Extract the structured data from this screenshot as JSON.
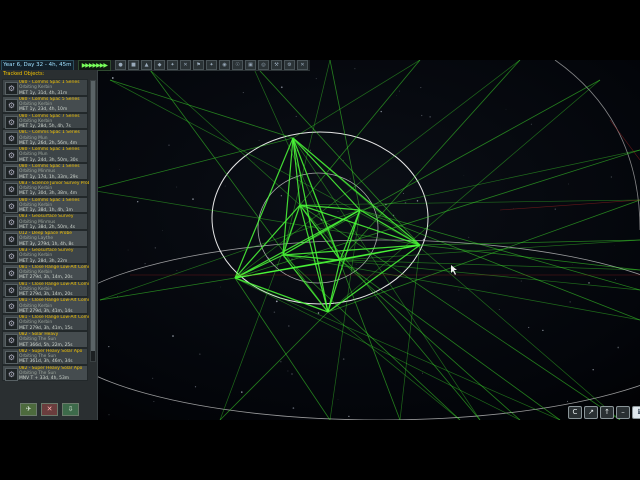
{
  "topbar": {
    "clock": "Year 6, Day 32 - 4h, 45m",
    "warp": "▶▶▶▶▶▶▶",
    "filters": [
      "●",
      "■",
      "▲",
      "◆",
      "✦",
      "✕",
      "⚑",
      "✦",
      "◉",
      "☉",
      "▣",
      "◎",
      "⚒",
      "⚙",
      "✕"
    ]
  },
  "panel": {
    "title": "Tracked Objects:",
    "items": [
      {
        "name": "080 - Comms Spac 1 Series",
        "status": "Orbiting Kerbin",
        "met": "MET 1y, 31d, 4h, 31m"
      },
      {
        "name": "080 - Comms Spac 5 Series",
        "status": "Orbiting Kerbin",
        "met": "MET 1y, 23d, 4h, 10m"
      },
      {
        "name": "080 - Comms Spac 7 Series",
        "status": "Orbiting Kerbin",
        "met": "MET 1y, 28d, 5h, 4h, 7s"
      },
      {
        "name": "08C - Comms Spac 1 Series",
        "status": "Orbiting Mun",
        "met": "MET 1y, 26d, 2h, 56m, 4m"
      },
      {
        "name": "080 - Comms Spac 1 Series",
        "status": "Orbiting Mun",
        "met": "MET 1y, 24d, 3h, 50m, 30s"
      },
      {
        "name": "080 - Comms Spac 1 Series",
        "status": "Orbiting Minmus",
        "met": "MET 1y, 17d, 1h, 33m, 29s"
      },
      {
        "name": "083 - Science Junior Survey Probe",
        "status": "Orbiting Kerbin",
        "met": "MET 1y, 30d, 3h, 38m, 4m"
      },
      {
        "name": "080 - Comms Spac 1 Series",
        "status": "Orbiting Kerbin",
        "met": "MET 1y, 38d, 1h, 4h, 1m"
      },
      {
        "name": "083 - Geosurface Survey",
        "status": "Orbiting Minmus",
        "met": "MET 1y, 38d, 2h, 50m, 4s"
      },
      {
        "name": "012 - Deep Space Probe",
        "status": "Orbiting Laythe",
        "met": "MET 3y, 279d, 1h, 4h, 8s"
      },
      {
        "name": "083 - Geosurface Survey",
        "status": "Orbiting Kerbin",
        "met": "MET 1y, 28d, 3h, 22m"
      },
      {
        "name": "081 - Close Range Low-Alt Comms P...",
        "status": "Orbiting Kerbin",
        "met": "MET 279d, 3h, 14m, 20s"
      },
      {
        "name": "081 - Close Range Low-Alt Comms P...",
        "status": "Orbiting Kerbin",
        "met": "MET 279d, 3h, 14m, 20s"
      },
      {
        "name": "081 - Close Range Low-Alt Comms P...",
        "status": "Orbiting Kerbin",
        "met": "MET 279d, 3h, 41m, 14s"
      },
      {
        "name": "081 - Close Range Low-Alt Comms P...",
        "status": "Orbiting Kerbin",
        "met": "MET 279d, 3h, 41m, 15s"
      },
      {
        "name": "082 - Solar Heavy",
        "status": "Orbiting The Sun",
        "met": "MET 366d, 5h, 22m, 25s"
      },
      {
        "name": "082 - Super Heavy Solar Apo",
        "status": "Orbiting The Sun",
        "met": "MET 361d, 3h, 46m, 34s"
      },
      {
        "name": "082 - Super Heavy Solar Apo",
        "status": "Orbiting The Sun",
        "met": "MNV T + 33d, 4h, 53m"
      }
    ],
    "buttons": {
      "fly": "✈",
      "delete": "✕",
      "recover": "⇩"
    }
  },
  "camera": {
    "buttons": [
      "C",
      "↗",
      "↑",
      "–",
      "ℹ"
    ]
  }
}
